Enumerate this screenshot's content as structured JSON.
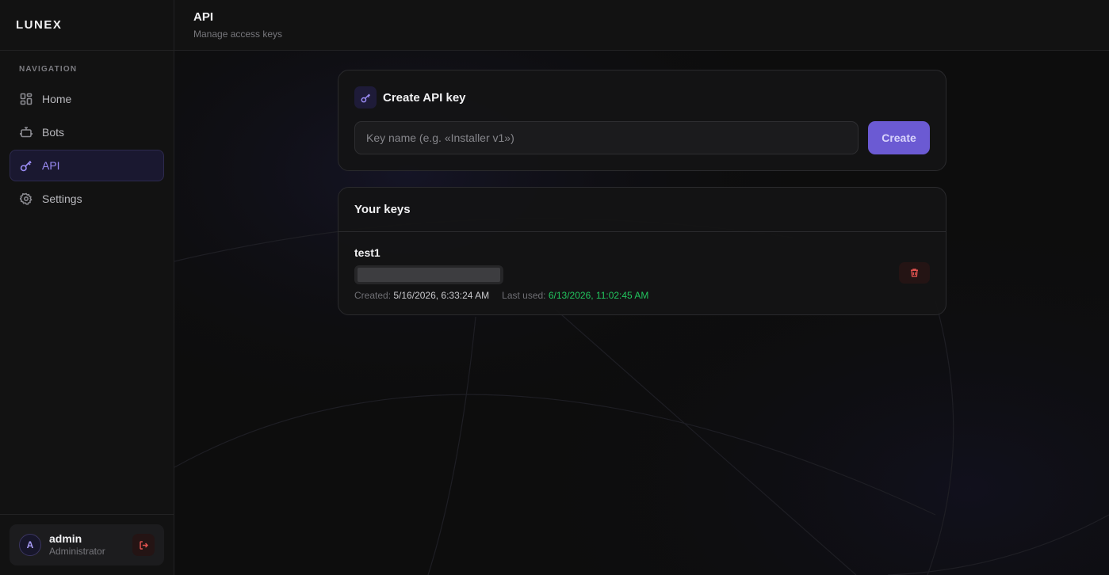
{
  "brand": {
    "name": "LUNEX"
  },
  "sidebar": {
    "section_label": "NAVIGATION",
    "items": [
      {
        "label": "Home",
        "icon": "dashboard-icon",
        "active": false
      },
      {
        "label": "Bots",
        "icon": "bot-icon",
        "active": false
      },
      {
        "label": "API",
        "icon": "key-icon",
        "active": true
      },
      {
        "label": "Settings",
        "icon": "gear-icon",
        "active": false
      }
    ]
  },
  "user": {
    "avatar_letter": "A",
    "name": "admin",
    "role": "Administrator",
    "logout_icon": "logout-icon"
  },
  "header": {
    "title": "API",
    "subtitle": "Manage access keys"
  },
  "create_card": {
    "title": "Create API key",
    "icon": "key-icon",
    "input_placeholder": "Key name (e.g. «Installer v1»)",
    "input_value": "",
    "button_label": "Create"
  },
  "keys_card": {
    "title": "Your keys",
    "keys": [
      {
        "name": "test1",
        "created_label": "Created:",
        "created_value": "5/16/2026, 6:33:24 AM",
        "last_used_label": "Last used:",
        "last_used_value": "6/13/2026, 11:02:45 AM",
        "delete_icon": "trash-icon"
      }
    ]
  },
  "colors": {
    "accent": "#9b8cf5",
    "primary_button": "#6b5ad3",
    "success": "#22c55e",
    "danger": "#e0524f",
    "background": "#0d0d0d"
  }
}
